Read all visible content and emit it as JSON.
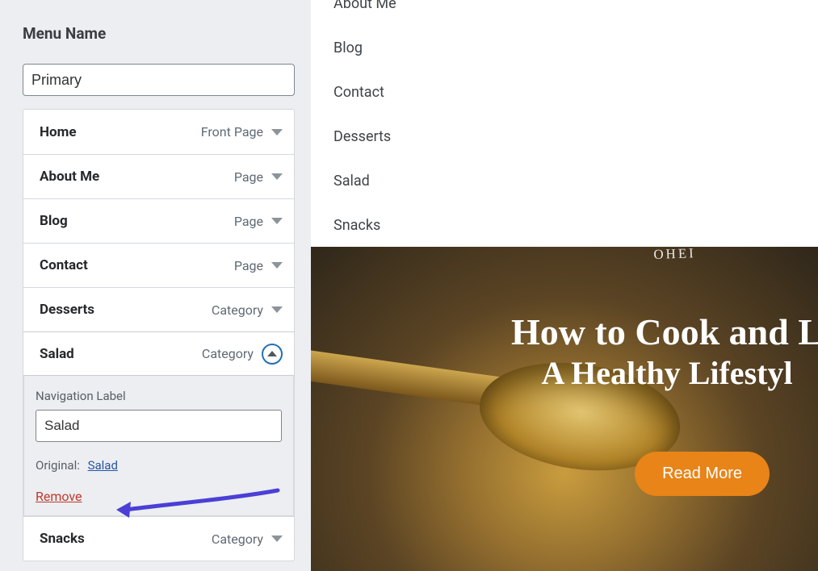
{
  "sidebar": {
    "section_title": "Menu Name",
    "menu_name_value": "Primary",
    "items": [
      {
        "label": "Home",
        "type": "Front Page"
      },
      {
        "label": "About Me",
        "type": "Page"
      },
      {
        "label": "Blog",
        "type": "Page"
      },
      {
        "label": "Contact",
        "type": "Page"
      },
      {
        "label": "Desserts",
        "type": "Category"
      },
      {
        "label": "Salad",
        "type": "Category"
      },
      {
        "label": "Snacks",
        "type": "Category"
      }
    ],
    "open_item_index": 5,
    "detail": {
      "nav_label_text": "Navigation Label",
      "nav_label_value": "Salad",
      "original_text": "Original:",
      "original_link": "Salad",
      "remove_text": "Remove"
    }
  },
  "preview": {
    "items": [
      "About Me",
      "Blog",
      "Contact",
      "Desserts",
      "Salad",
      "Snacks"
    ],
    "hero": {
      "title_line1": "How to Cook and L",
      "title_line2": "A Healthy Lifestyl",
      "logo_text": "ᴼᴴᴱᴵ",
      "button": "Read More"
    }
  },
  "colors": {
    "accent_blue": "#2271b1",
    "link_blue": "#2755a3",
    "remove_red": "#c0392b",
    "cta_orange": "#e88418",
    "callout": "#4b3fd6"
  }
}
